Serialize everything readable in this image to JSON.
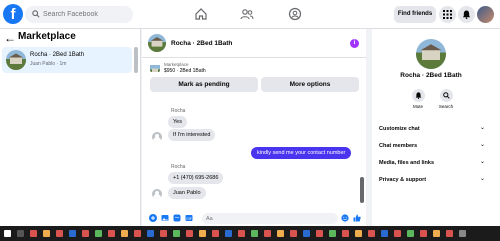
{
  "topbar": {
    "logo": "f",
    "search_placeholder": "Search Facebook",
    "find_friends": "Find friends"
  },
  "sidebar": {
    "title": "Marketplace",
    "conversations": [
      {
        "name": "Rocha · 2Bed 1Bath",
        "subtitle": "Juan Pablo · 1m"
      }
    ]
  },
  "chat": {
    "title": "Rocha · 2Bed 1Bath",
    "listing_label": "Marketplace",
    "listing_price": "$950 · 2Bed 1Bath",
    "mark_pending": "Mark as pending",
    "more_options": "More options",
    "messages": {
      "sender1": "Rocha",
      "m1": "Yes",
      "m2": "If I'm interested",
      "m3": "kindly send me your contact number",
      "sender2": "Rocha",
      "m4": "+1 (470) 695-2686",
      "m5": "Juan Pablo"
    },
    "composer_placeholder": "Aa"
  },
  "details": {
    "name": "Rocha · 2Bed 1Bath",
    "mute": "Mute",
    "search": "Search",
    "menu": [
      "Customize chat",
      "Chat members",
      "Media, files and links",
      "Privacy & support"
    ]
  },
  "colors": {
    "brand": "#1877f2",
    "outgoing_bubble": "#4a34f0",
    "info": "#a033ff"
  }
}
